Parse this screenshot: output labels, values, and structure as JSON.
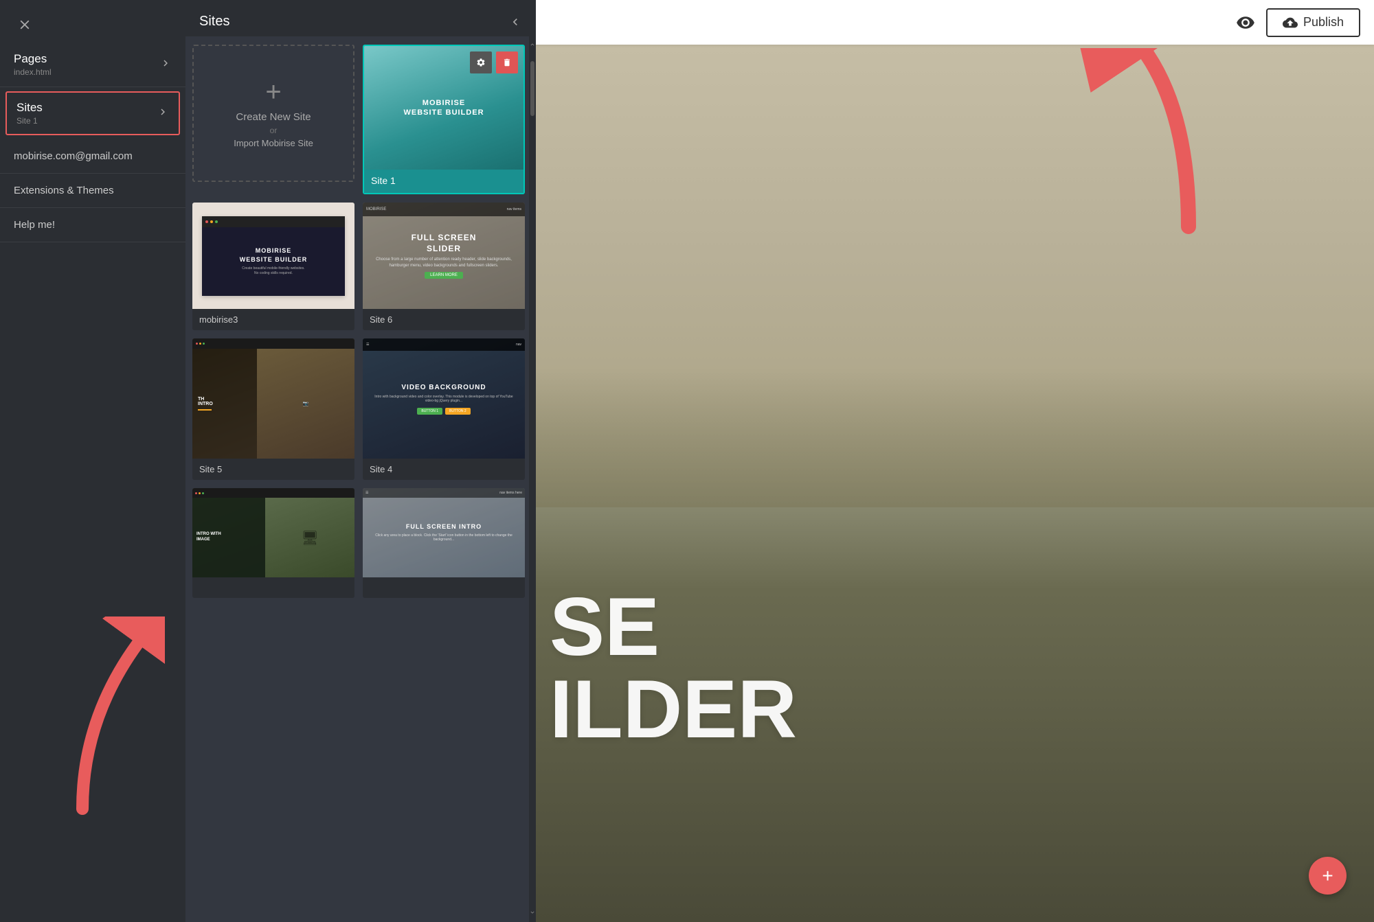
{
  "sidebar": {
    "close_label": "✕",
    "pages_label": "Pages",
    "pages_sub": "index.html",
    "sites_label": "Sites",
    "sites_sub": "Site 1",
    "email_label": "mobirise.com@gmail.com",
    "extensions_label": "Extensions & Themes",
    "help_label": "Help me!"
  },
  "sites_panel": {
    "title": "Sites",
    "create_new_label": "Create New Site",
    "create_or": "or",
    "import_label": "Import Mobirise Site",
    "cards": [
      {
        "id": "site1",
        "thumb_text_line1": "MOBIRISE",
        "thumb_text_line2": "WEBSITE BUILDER",
        "label": "Site 1",
        "type": "mobirise"
      },
      {
        "id": "mobirise3",
        "thumb_text_line1": "MOBIRISE",
        "thumb_text_line2": "WEBSITE BUILDER",
        "label": "mobirise3",
        "type": "mobirise3"
      },
      {
        "id": "site6",
        "thumb_text_line1": "FULL SCREEN",
        "thumb_text_line2": "SLIDER",
        "label": "Site 6",
        "type": "slider"
      },
      {
        "id": "site5",
        "thumb_text_line1": "TH INTRO",
        "label": "Site 5",
        "type": "video"
      },
      {
        "id": "site4",
        "thumb_text_line1": "VIDEO BACKGROUND",
        "label": "Site 4",
        "type": "video_bg"
      },
      {
        "id": "intro_img",
        "thumb_text_line1": "INTRO WITH IMAGE",
        "label": "",
        "type": "intro_img"
      },
      {
        "id": "fullscreen_intro",
        "thumb_text_line1": "FULL SCREEN INTRO",
        "label": "",
        "type": "fullscreen_intro"
      }
    ]
  },
  "toolbar": {
    "publish_label": "Publish"
  },
  "main": {
    "hero_text_line1": "SE",
    "hero_text_line2": "ILDER"
  },
  "icons": {
    "close": "✕",
    "chevron_right": "›",
    "chevron_left": "‹",
    "plus": "+",
    "gear": "⚙",
    "trash": "🗑",
    "eye": "👁",
    "upload": "↑",
    "red_plus": "+"
  }
}
